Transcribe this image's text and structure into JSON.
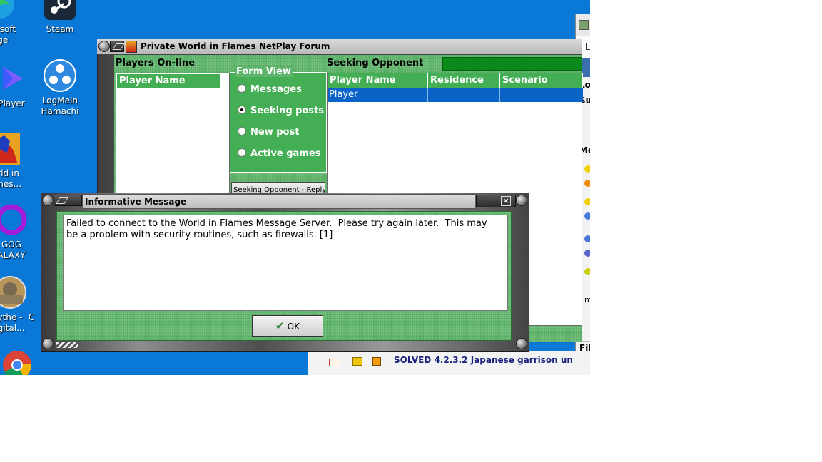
{
  "desktop": {
    "icons": [
      {
        "label": "icrosoft\ndge",
        "icon": "edge-icon"
      },
      {
        "label": "Steam",
        "icon": "steam-icon"
      },
      {
        "label": "Player",
        "icon": "media-player-icon"
      },
      {
        "label": "LogMeIn\nHamachi",
        "icon": "hamachi-icon"
      },
      {
        "label": "orld in\names...",
        "icon": "world-in-flames-icon"
      },
      {
        "label": "GOG\nALAXY",
        "icon": "gog-galaxy-icon"
      },
      {
        "label": "ythe -\nigital...",
        "icon": "scythe-icon"
      },
      {
        "label": "C",
        "icon": "partial-icon"
      }
    ]
  },
  "main_window": {
    "title": "Private World in Flames NetPlay Forum",
    "players_online_label": "Players On-line",
    "players_list_header": "Player Name",
    "form_view": {
      "legend": "Form View",
      "options": [
        "Messages",
        "Seeking posts",
        "New post",
        "Active games"
      ],
      "selected": "Seeking posts"
    },
    "seeking_label": "Seeking Opponent",
    "seek_button_partial": "Seeking Opponent - Reply",
    "table": {
      "columns": [
        "Player Name",
        "Residence",
        "Scenario"
      ],
      "rows": [
        [
          "Player",
          "",
          ""
        ]
      ]
    }
  },
  "dialog": {
    "title": "Informative Message",
    "message": "Failed to connect to the World in Flames Message Server.  Please try again later.  This may\nbe a problem with security routines, such as firewalls. [1]",
    "ok_label": "OK"
  },
  "browser": {
    "labels": [
      "Lo",
      "Su",
      "Me",
      "m",
      "Fil"
    ]
  },
  "forum_row": {
    "text": "SOLVED 4.2.3.2 Japanese garrison un"
  },
  "colors": {
    "desktop": "#0a78d7",
    "felt_green": "#5fb46b",
    "header_green": "#44ae54",
    "selection": "#0a64c8"
  }
}
